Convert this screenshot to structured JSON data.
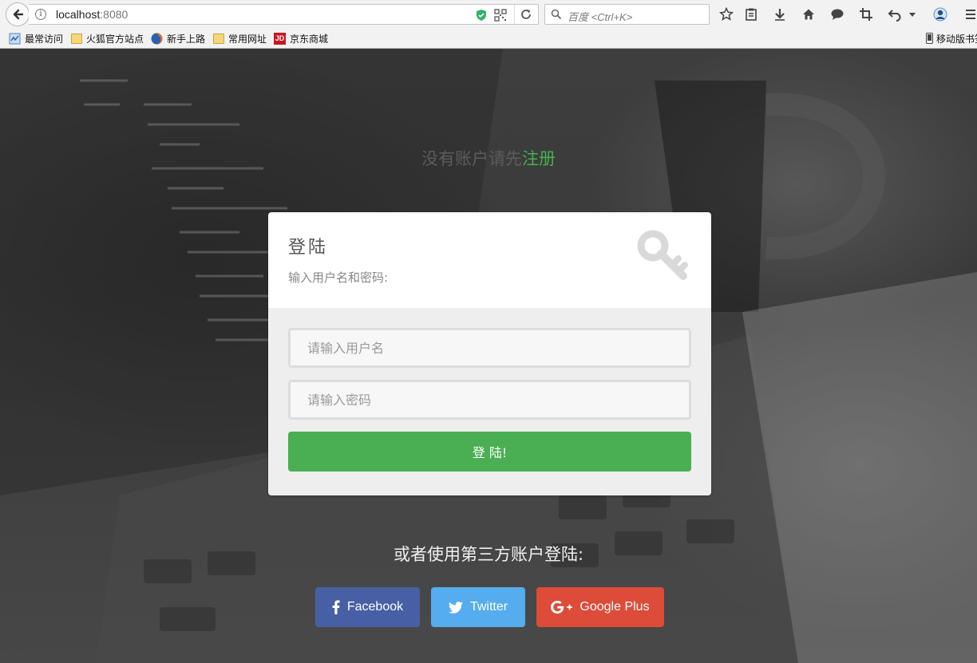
{
  "browser": {
    "url_host": "localhost",
    "url_port": ":8080",
    "search_placeholder": "百度 <Ctrl+K>",
    "bookmarks": [
      {
        "label": "最常访问",
        "icon": "most-visited-icon"
      },
      {
        "label": "火狐官方站点",
        "icon": "folder-icon"
      },
      {
        "label": "新手上路",
        "icon": "firefox-icon"
      },
      {
        "label": "常用网址",
        "icon": "folder-icon"
      },
      {
        "label": "京东商城",
        "icon": "jd-icon"
      }
    ],
    "mobile_bookmarks_label": "移动版书签"
  },
  "register_prompt": {
    "text": "没有账户请先",
    "link": "注册"
  },
  "login_card": {
    "title": "登陆",
    "subtitle": "输入用户名和密码:",
    "username_placeholder": "请输入用户名",
    "password_placeholder": "请输入密码",
    "submit_label": "登 陆!"
  },
  "third_party": {
    "heading": "或者使用第三方账户登陆:",
    "buttons": [
      {
        "label": "Facebook",
        "icon": "facebook-icon",
        "color": "#4760a5"
      },
      {
        "label": "Twitter",
        "icon": "twitter-icon",
        "color": "#55acee"
      },
      {
        "label": "Google Plus",
        "icon": "google-plus-icon",
        "color": "#dd4b39"
      }
    ]
  },
  "colors": {
    "accent_green": "#4aae52",
    "register_link": "#47b051"
  }
}
